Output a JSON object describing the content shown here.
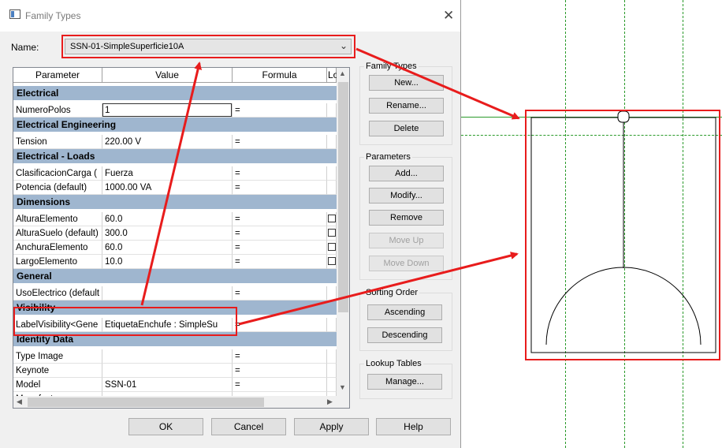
{
  "dialog": {
    "title": "Family Types",
    "close_glyph": "✕",
    "name_label": "Name:",
    "name_value": "SSN-01-SimpleSuperficie10A"
  },
  "table": {
    "columns": [
      "Parameter",
      "Value",
      "Formula",
      "Lo"
    ],
    "groups": [
      {
        "label": "Electrical",
        "rows": [
          {
            "param": "NumeroPolos",
            "value": "1",
            "formula": "=",
            "lock": false,
            "editing": true
          }
        ]
      },
      {
        "label": "Electrical Engineering",
        "rows": [
          {
            "param": "Tension",
            "value": "220.00 V",
            "formula": "=",
            "lock": false
          }
        ]
      },
      {
        "label": "Electrical - Loads",
        "rows": [
          {
            "param": "ClasificacionCarga (",
            "value": "Fuerza",
            "formula": "=",
            "lock": false
          },
          {
            "param": "Potencia (default)",
            "value": "1000.00 VA",
            "formula": "=",
            "lock": false
          }
        ]
      },
      {
        "label": "Dimensions",
        "rows": [
          {
            "param": "AlturaElemento",
            "value": "60.0",
            "formula": "=",
            "lock": true
          },
          {
            "param": "AlturaSuelo (default)",
            "value": "300.0",
            "formula": "=",
            "lock": true
          },
          {
            "param": "AnchuraElemento",
            "value": "60.0",
            "formula": "=",
            "lock": true
          },
          {
            "param": "LargoElemento",
            "value": "10.0",
            "formula": "=",
            "lock": true
          }
        ]
      },
      {
        "label": "General",
        "rows": [
          {
            "param": "UsoElectrico (default",
            "value": "",
            "formula": "=",
            "lock": false
          }
        ]
      },
      {
        "label": "Visibility",
        "rows": [
          {
            "param": "LabelVisibility<Gene",
            "value": "EtiquetaEnchufe : SimpleSu",
            "formula": "=",
            "lock": false
          }
        ]
      },
      {
        "label": "Identity Data",
        "rows": [
          {
            "param": "Type Image",
            "value": "",
            "formula": "=",
            "lock": false
          },
          {
            "param": "Keynote",
            "value": "",
            "formula": "=",
            "lock": false
          },
          {
            "param": "Model",
            "value": "SSN-01",
            "formula": "=",
            "lock": false
          },
          {
            "param": "Manufacturer",
            "value": "",
            "formula": "=",
            "lock": false
          }
        ]
      }
    ]
  },
  "family_types": {
    "label": "Family Types",
    "new": "New...",
    "rename": "Rename...",
    "delete": "Delete"
  },
  "parameters": {
    "label": "Parameters",
    "add": "Add...",
    "modify": "Modify...",
    "remove": "Remove",
    "move_up": "Move Up",
    "move_down": "Move Down"
  },
  "sorting": {
    "label": "Sorting Order",
    "ascending": "Ascending",
    "descending": "Descending"
  },
  "lookup": {
    "label": "Lookup Tables",
    "manage": "Manage..."
  },
  "footer": {
    "ok": "OK",
    "cancel": "Cancel",
    "apply": "Apply",
    "help": "Help"
  },
  "colors": {
    "annotation_red": "#e81c1c",
    "group_header": "#9fb6cf",
    "ref_plane_green": "#2a9a2a"
  }
}
